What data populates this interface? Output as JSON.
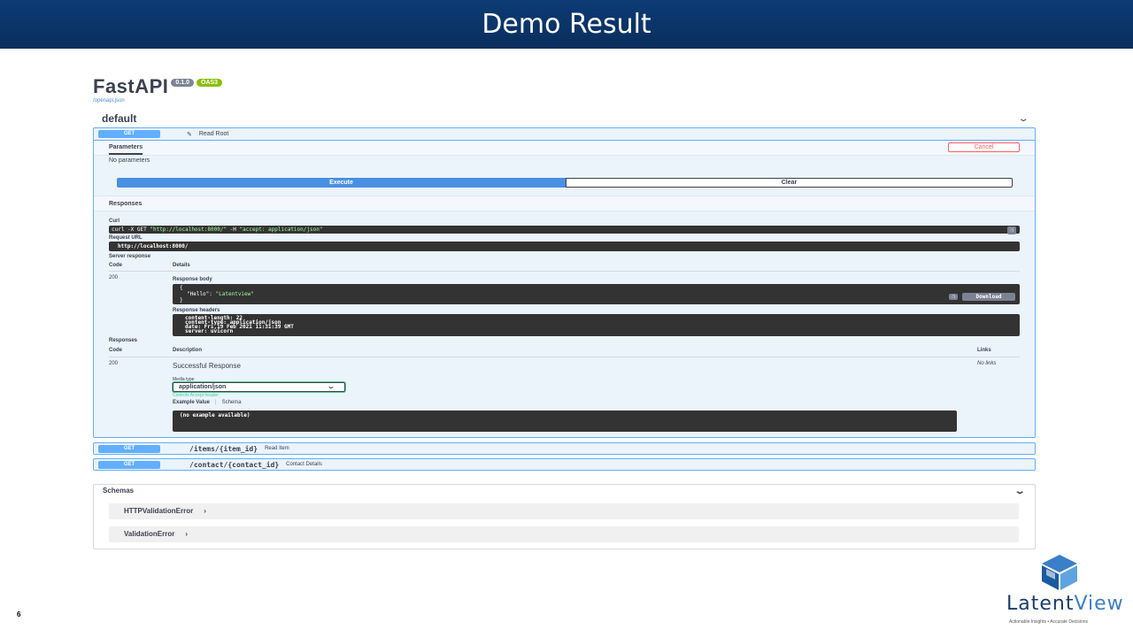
{
  "slide": {
    "title": "Demo Result",
    "page_number": "6",
    "logo_text_dark": "Latent",
    "logo_text_light": "View",
    "logo_tagline": "Actionable Insights • Accurate Decisions"
  },
  "swagger": {
    "app_title": "FastAPI",
    "version_badge": "0.1.0",
    "oas_badge": "OAS3",
    "openapi_link": "/openapi.json",
    "tag_name": "default",
    "open_operation": {
      "method": "GET",
      "path": "/",
      "summary": "Read Root",
      "parameters_tab": "Parameters",
      "cancel_label": "Cancel",
      "no_parameters": "No parameters",
      "execute_label": "Execute",
      "clear_label": "Clear",
      "responses_heading": "Responses",
      "curl_label": "Curl",
      "curl_prefix": "curl -X GET ",
      "curl_url": "\"http://localhost:8000/\"",
      "curl_flag": " -H ",
      "curl_header": "\"accept: application/json\"",
      "request_url_label": "Request URL",
      "request_url": "http://localhost:8000/",
      "server_response_label": "Server response",
      "code_col": "Code",
      "details_col": "Details",
      "response_code": "200",
      "response_body_label": "Response body",
      "body_open": "{",
      "body_key": "\"Hello\"",
      "body_sep": ": ",
      "body_value": "\"Latentview\"",
      "body_close": "}",
      "download_label": "Download",
      "response_headers_label": "Response headers",
      "headers": [
        "content-length: 22",
        "content-type: application/json",
        "date: Fri,19 Feb 2021 11:31:39 GMT",
        "server: uvicorn"
      ],
      "responses_label": "Responses",
      "description_col": "Description",
      "links_col": "Links",
      "doc_code": "200",
      "doc_description": "Successful Response",
      "no_links": "No links",
      "media_type_label": "Media type",
      "media_type_value": "application/json",
      "controls_accept": "Controls Accept header.",
      "example_value_tab": "Example Value",
      "schema_tab": "Schema",
      "example_text": "(no example available)"
    },
    "collapsed_operations": [
      {
        "method": "GET",
        "path": "/items/{item_id}",
        "summary": "Read Item"
      },
      {
        "method": "GET",
        "path": "/contact/{contact_id}",
        "summary": "Contact Details"
      }
    ],
    "schemas": {
      "heading": "Schemas",
      "models": [
        "HTTPValidationError",
        "ValidationError"
      ]
    }
  }
}
